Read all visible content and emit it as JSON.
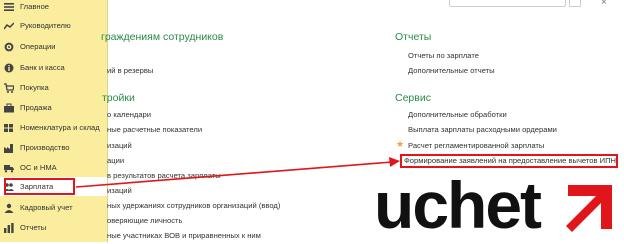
{
  "sidebar": {
    "items": [
      {
        "label": "Главное",
        "icon": "menu-lines-icon"
      },
      {
        "label": "Руководителю",
        "icon": "trend-chart-icon"
      },
      {
        "label": "Операции",
        "icon": "gear-icon"
      },
      {
        "label": "Банк и касса",
        "icon": "info-circle-icon"
      },
      {
        "label": "Покупка",
        "icon": "shopping-cart-icon"
      },
      {
        "label": "Продажа",
        "icon": "briefcase-icon"
      },
      {
        "label": "Номенклатура и склад",
        "icon": "stock-icon"
      },
      {
        "label": "Производство",
        "icon": "factory-icon"
      },
      {
        "label": "ОС и НМА",
        "icon": "truck-icon"
      },
      {
        "label": "Зарплата",
        "icon": "people-icon"
      },
      {
        "label": "Кадровый учет",
        "icon": "people-icon"
      },
      {
        "label": "Отчеты",
        "icon": "bar-chart-icon"
      }
    ]
  },
  "main": {
    "left_section_title_1": "граждениям сотрудников",
    "left_link_1": "ий в резервы",
    "left_section_title_2": "тройки",
    "left_links": [
      "о календари",
      "ные расчетные показатели",
      "изаций",
      "ации",
      "в результатов расчета зарплаты",
      "изаций",
      "ных удержаниях сотрудников организаций (ввод)",
      "оверяющие личность",
      "ные участниках ВОВ и приравненных к ним"
    ],
    "reports_title": "Отчеты",
    "reports_links": [
      "Отчеты по зарплате",
      "Дополнительные отчеты"
    ],
    "service_title": "Сервис",
    "service_links": [
      "Дополнительные обработки",
      "Выплата зарплаты расходными ордерами",
      "Расчет регламентированной зарплаты",
      "Формирование заявлений на предоставление вычетов ИПН"
    ],
    "star_symbol": "★"
  },
  "logo_text": "uchet",
  "colors": {
    "sidebar_bg": "#fbed9e",
    "section_title": "#2a8a4a",
    "highlight_red": "#e0161b",
    "star": "#f0a030"
  }
}
